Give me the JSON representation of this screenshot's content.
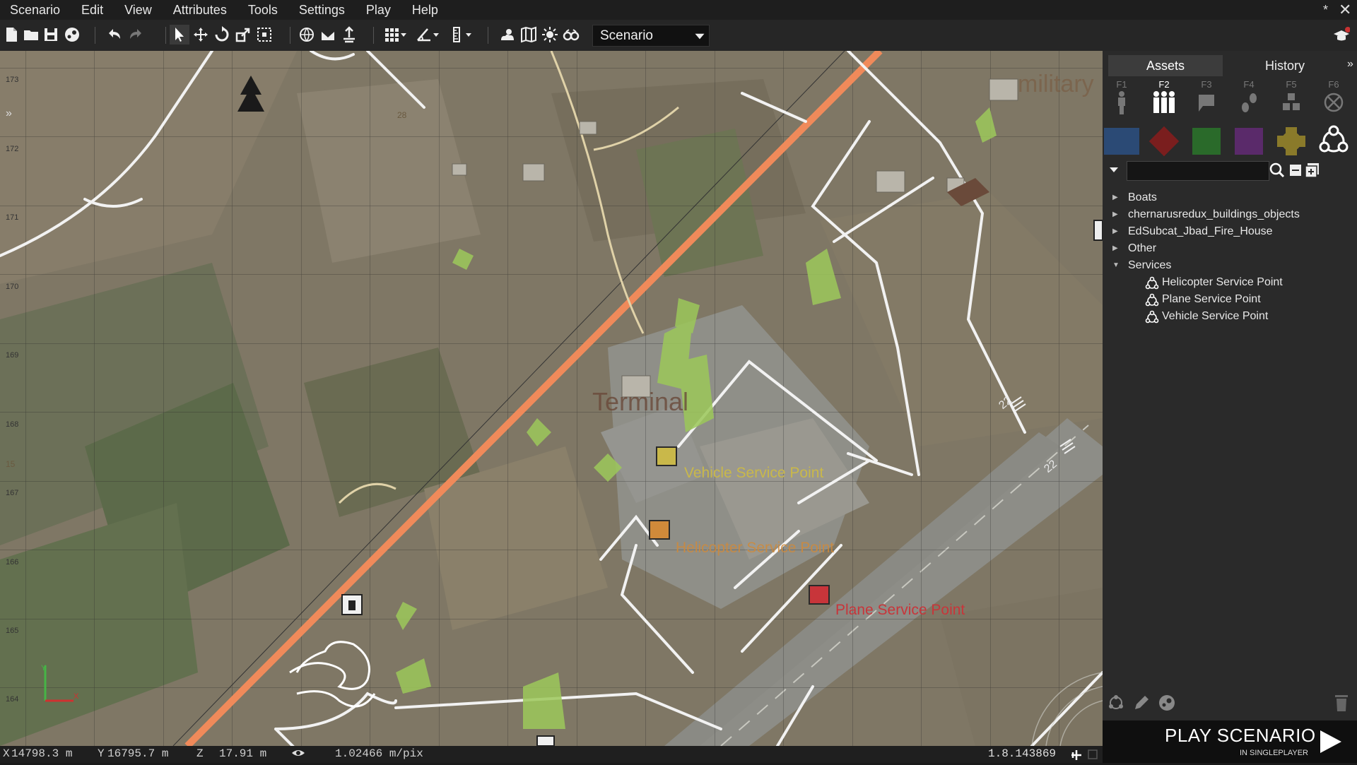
{
  "menu": {
    "items": [
      "Scenario",
      "Edit",
      "View",
      "Attributes",
      "Tools",
      "Settings",
      "Play",
      "Help"
    ],
    "modified_marker": "*",
    "close_glyph": "✕"
  },
  "toolbar": {
    "scenario_select": "Scenario"
  },
  "map": {
    "grid_y_labels": [
      "173",
      "172",
      "171",
      "170",
      "169",
      "168",
      "167",
      "166",
      "165",
      "164"
    ],
    "labels": {
      "military": "military",
      "terminal": "Terminal",
      "vehicle_service": "Vehicle Service Point",
      "helicopter_service": "Helicopter Service Point",
      "plane_service": "Plane Service Point",
      "runway_a": "22",
      "runway_b": "22",
      "small_28": "28",
      "small_15": "15"
    },
    "colors": {
      "highway": "#f08a5a",
      "vehicle_label": "#c9b84a",
      "helicopter_label": "#d08a3a",
      "plane_label": "#c8353a",
      "service_icon_yellow": "#c9b84a",
      "service_icon_orange": "#d08a3a",
      "service_icon_red": "#c8353a"
    },
    "axis_gizmo": {
      "y": "Y",
      "x": "X"
    }
  },
  "status": {
    "x_label": "X",
    "x_value": "14798.3 m",
    "y_label": "Y",
    "y_value": "16795.7 m",
    "z_label": "Z",
    "z_value": "17.91 m",
    "scale": "1.02466 m/pix",
    "version": "1.8.143869"
  },
  "panel": {
    "tabs": [
      "Assets",
      "History"
    ],
    "fkeys": [
      "F1",
      "F2",
      "F3",
      "F4",
      "F5",
      "F6"
    ],
    "faction_colors": [
      "#2b4a75",
      "#7a1e1e",
      "#2a6a2a",
      "#5a2a6a",
      "#8a7a2a"
    ],
    "search_value": "",
    "tree": [
      {
        "label": "Boats",
        "expanded": false
      },
      {
        "label": "chernarusredux_buildings_objects",
        "expanded": false
      },
      {
        "label": "EdSubcat_Jbad_Fire_House",
        "expanded": false
      },
      {
        "label": "Other",
        "expanded": false
      },
      {
        "label": "Services",
        "expanded": true,
        "children": [
          "Helicopter Service Point",
          "Plane Service Point",
          "Vehicle Service Point"
        ]
      }
    ]
  },
  "play": {
    "title": "PLAY SCENARIO",
    "subtitle": "IN SINGLEPLAYER"
  }
}
